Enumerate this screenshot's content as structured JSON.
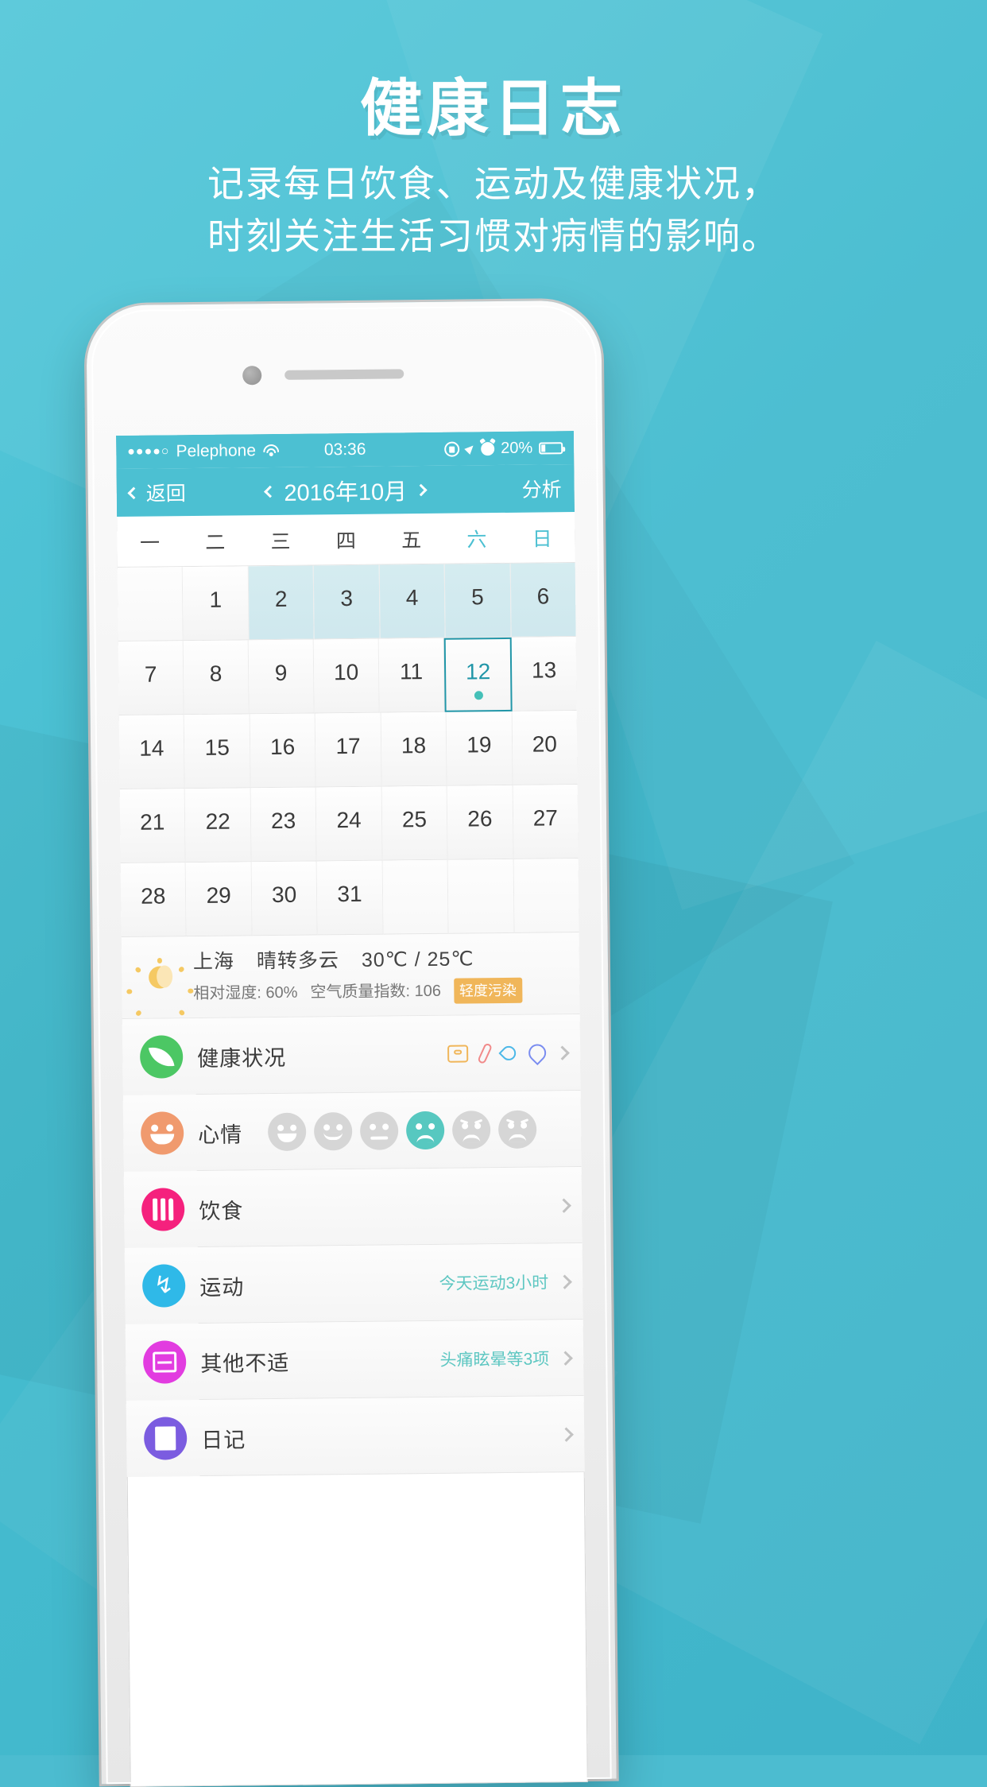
{
  "promo": {
    "title": "健康日志",
    "subtitle_line1": "记录每日饮食、运动及健康状况，",
    "subtitle_line2": "时刻关注生活习惯对病情的影响。",
    "accent_color": "#4cc0d2"
  },
  "status_bar": {
    "signal_dots": "●●●●○",
    "carrier": "Pelephone",
    "wifi_icon": "wifi-icon",
    "time": "03:36",
    "rotation_lock_icon": "rotation-lock-icon",
    "location_icon": "location-arrow-icon",
    "alarm_icon": "alarm-clock-icon",
    "battery_percent": "20%",
    "battery_icon": "battery-icon"
  },
  "navbar": {
    "back_label": "返回",
    "month_title": "2016年10月",
    "prev_icon": "chevron-left-icon",
    "next_icon": "chevron-right-icon",
    "right_label": "分析"
  },
  "calendar": {
    "weekdays": [
      "一",
      "二",
      "三",
      "四",
      "五",
      "六",
      "日"
    ],
    "weekend_indices": [
      5,
      6
    ],
    "selected_day": "12",
    "highlighted_days": [
      "2",
      "3",
      "4",
      "5",
      "6"
    ],
    "rows": [
      [
        "",
        "1",
        "2",
        "3",
        "4",
        "5",
        "6"
      ],
      [
        "7",
        "8",
        "9",
        "10",
        "11",
        "12",
        "13"
      ],
      [
        "14",
        "15",
        "16",
        "17",
        "18",
        "19",
        "20"
      ],
      [
        "21",
        "22",
        "23",
        "24",
        "25",
        "26",
        "27"
      ],
      [
        "28",
        "29",
        "30",
        "31",
        "",
        "",
        ""
      ]
    ]
  },
  "weather": {
    "icon": "sun-behind-moon-icon",
    "city": "上海",
    "condition": "晴转多云",
    "temperature": "30℃ / 25℃",
    "humidity_label": "相对湿度: 60%",
    "aqi_label": "空气质量指数: 106",
    "aqi_badge": "轻度污染",
    "badge_color": "#f0b65a"
  },
  "entries": [
    {
      "id": "health-status",
      "icon": "leaf-icon",
      "icon_color": "#4cc764",
      "label": "健康状况",
      "value": "",
      "mini_icons": [
        "scale-icon",
        "thermometer-icon",
        "blood-drop-icon",
        "stethoscope-icon"
      ]
    },
    {
      "id": "mood",
      "icon": "smiley-icon",
      "icon_color": "#f09a6e",
      "label": "心情",
      "value": "",
      "moods": [
        "happy",
        "smile",
        "neutral",
        "sad",
        "worried",
        "upset"
      ],
      "selected_mood_index": 3,
      "selected_color": "#57c8c0"
    },
    {
      "id": "diet",
      "icon": "cutlery-icon",
      "icon_color": "#f5217d",
      "label": "饮食",
      "value": ""
    },
    {
      "id": "exercise",
      "icon": "runner-icon",
      "icon_color": "#2fb9e8",
      "label": "运动",
      "value": "今天运动3小时"
    },
    {
      "id": "discomfort",
      "icon": "heartbeat-icon",
      "icon_color": "#e23ce0",
      "label": "其他不适",
      "value": "头痛眩晕等3项"
    },
    {
      "id": "diary",
      "icon": "book-icon",
      "icon_color": "#7b5ce0",
      "label": "日记",
      "value": ""
    }
  ]
}
